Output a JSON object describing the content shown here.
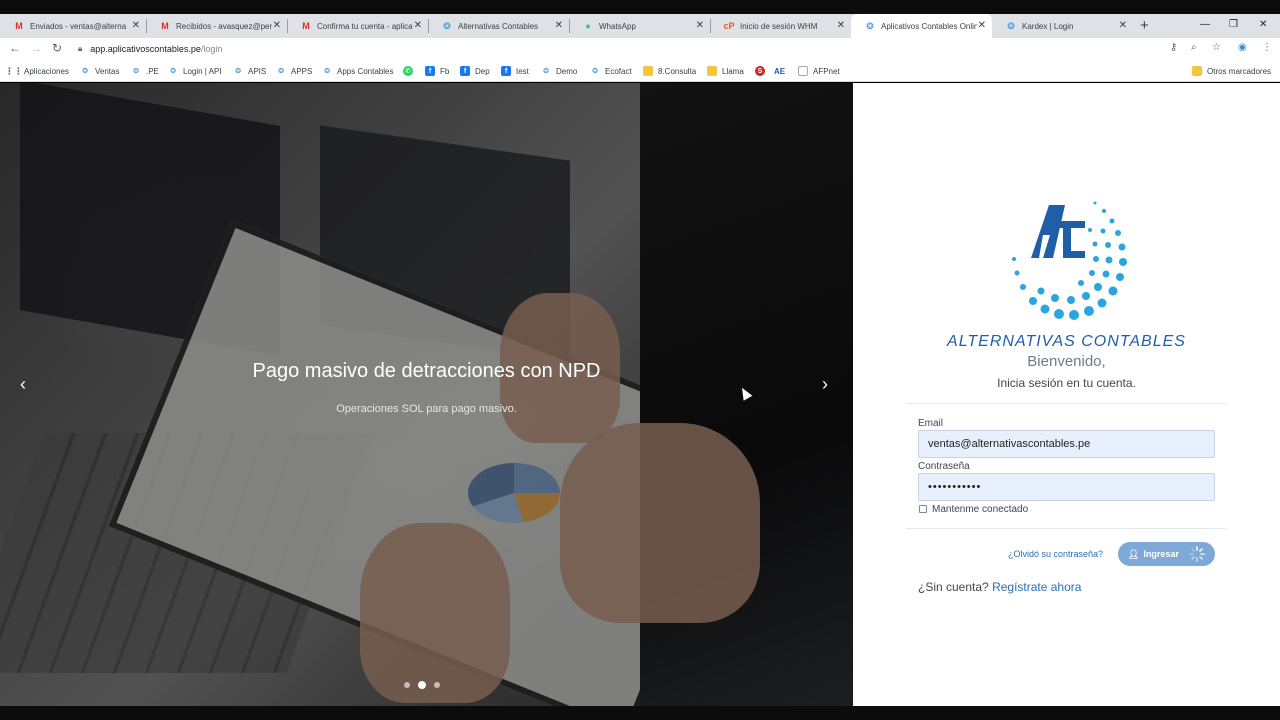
{
  "browser": {
    "tabs": [
      {
        "title": "Enviados - ventas@alternat",
        "icon": "gmail-icon"
      },
      {
        "title": "Recibidos - avasquez@peru",
        "icon": "gmail-icon"
      },
      {
        "title": "Confirma tu cuenta - aplicat",
        "icon": "gmail-icon"
      },
      {
        "title": "Alternativas Contables",
        "icon": "app-icon"
      },
      {
        "title": "WhatsApp",
        "icon": "whatsapp-icon"
      },
      {
        "title": "Inicio de sesión WHM",
        "icon": "cpanel-icon"
      },
      {
        "title": "Aplicativos Contables Onlin",
        "icon": "app-icon"
      },
      {
        "title": "Kardex | Login",
        "icon": "app-icon"
      }
    ],
    "url_host": "app.aplicativoscontables.pe",
    "url_path": "/login",
    "bookmarks": [
      {
        "label": "Aplicaciones",
        "icon": "apps-grid-icon"
      },
      {
        "label": "Ventas",
        "icon": "app-icon"
      },
      {
        "label": ".PE",
        "icon": "app-icon"
      },
      {
        "label": "Login | API",
        "icon": "app-icon"
      },
      {
        "label": "APIS",
        "icon": "app-icon"
      },
      {
        "label": "APPS",
        "icon": "app-icon"
      },
      {
        "label": "Apps Contables",
        "icon": "app-icon"
      },
      {
        "label": "",
        "icon": "whatsapp-icon"
      },
      {
        "label": "Fb",
        "icon": "facebook-icon"
      },
      {
        "label": "Dep",
        "icon": "facebook-icon"
      },
      {
        "label": "test",
        "icon": "facebook-icon"
      },
      {
        "label": "Demo",
        "icon": "app-icon"
      },
      {
        "label": "Ecofact",
        "icon": "app-icon"
      },
      {
        "label": "8.Consulta",
        "icon": "folder-icon"
      },
      {
        "label": "Llama",
        "icon": "folder-icon"
      },
      {
        "label": "",
        "icon": "sunat-icon"
      },
      {
        "label": "AE",
        "icon": "ae-icon"
      },
      {
        "label": "AFPnet",
        "icon": "page-icon"
      }
    ],
    "other_bookmarks": "Otros marcadores"
  },
  "carousel": {
    "title": "Pago masivo de detracciones con NPD",
    "subtitle": "Operaciones SOL para pago masivo.",
    "active_slide": 2,
    "slide_count": 3
  },
  "login": {
    "brand": "ALTERNATIVAS CONTABLES",
    "welcome": "Bienvenido,",
    "subtitle": "Inicia sesión en tu cuenta.",
    "email_label": "Email",
    "email_value": "ventas@alternativascontables.pe",
    "password_label": "Contraseña",
    "password_value": "•••••••••••",
    "remember_label": "Mantenme conectado",
    "forgot_link": "¿Olvidó su contraseña?",
    "login_button": "Ingresar",
    "no_account": "¿Sin cuenta?",
    "register_link": "Regístrate ahora"
  },
  "colors": {
    "brand_blue": "#1f5fa8",
    "button": "#7ea9d6",
    "link": "#2a6fb0"
  }
}
